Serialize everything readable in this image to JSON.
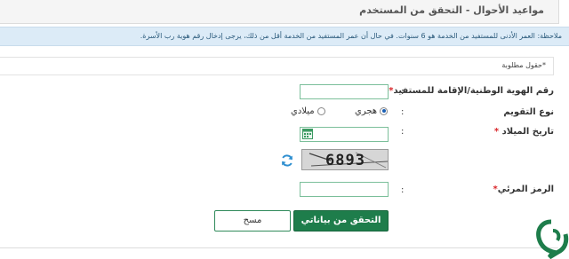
{
  "header": {
    "title": "مواعيد الأحوال - التحقق من المستخدم"
  },
  "notice": {
    "text": "ملاحظة: العمر الأدنى للمستفيد من الخدمة هو 6 سنوات. في حال أن عمر المستفيد من الخدمة أقل من ذلك، يرجى إدخال رقم هوية رب الأسرة."
  },
  "form": {
    "required_note": "*حقول مطلوبة",
    "id_label": "رقم الهوية الوطنية/الإقامة للمستفيد",
    "id_value": "",
    "calendar_label": "نوع التقويم",
    "calendar_hijri": "هجري",
    "calendar_gregorian": "ميلادي",
    "calendar_selected": "هجري",
    "birthdate_label": "تاريخ الميلاد",
    "birthdate_value": "",
    "captcha_text": "6893",
    "code_label": "الرمز المرئي",
    "code_value": "",
    "colon": ":",
    "star": "*"
  },
  "buttons": {
    "verify": "التحقق من بياناتي",
    "clear": "مسح"
  },
  "colors": {
    "primary": "#1e7d4b",
    "required": "#d9262a",
    "notice_bg": "#dcebf7",
    "field_border": "#7bbf9a"
  }
}
